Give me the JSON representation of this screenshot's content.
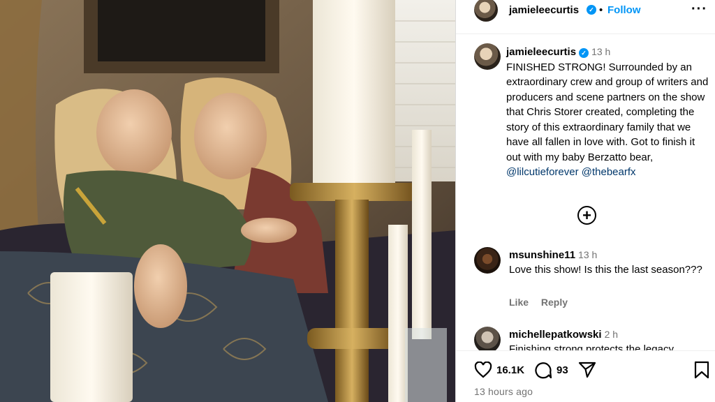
{
  "post": {
    "header": {
      "username": "jamieleecurtis",
      "dot": "•",
      "follow_label": "Follow",
      "more_label": "···"
    },
    "caption": {
      "username": "jamieleecurtis",
      "time": "13 h",
      "text": "FINISHED STRONG! Surrounded by an extraordinary crew and group of writers and producers and scene partners on the show that Chris Storer created, completing the story of this extraordinary family that we have all fallen in love with. Got to finish it out with my baby Berzatto bear,",
      "mention_1": "@lilcutieforever",
      "mention_2": "@thebearfx"
    },
    "add_icon": "+",
    "comments": [
      {
        "username": "msunshine11",
        "time": "13 h",
        "text": "Love this show! Is this the last season???",
        "like_label": "Like",
        "reply_label": "Reply"
      },
      {
        "username": "michellepatkowski",
        "time": "2 h",
        "text": "Finishing strong protects the legacy"
      }
    ],
    "footer": {
      "likes": "16.1K",
      "comments": "93",
      "posted_ago": "13 hours ago"
    },
    "colors": {
      "accent": "#0095f6",
      "mention": "#00376b",
      "muted": "#737373"
    },
    "icons": [
      "verified-badge-icon",
      "more-options-icon",
      "add-comment-icon",
      "heart-icon",
      "comment-icon",
      "share-icon",
      "bookmark-icon"
    ]
  }
}
